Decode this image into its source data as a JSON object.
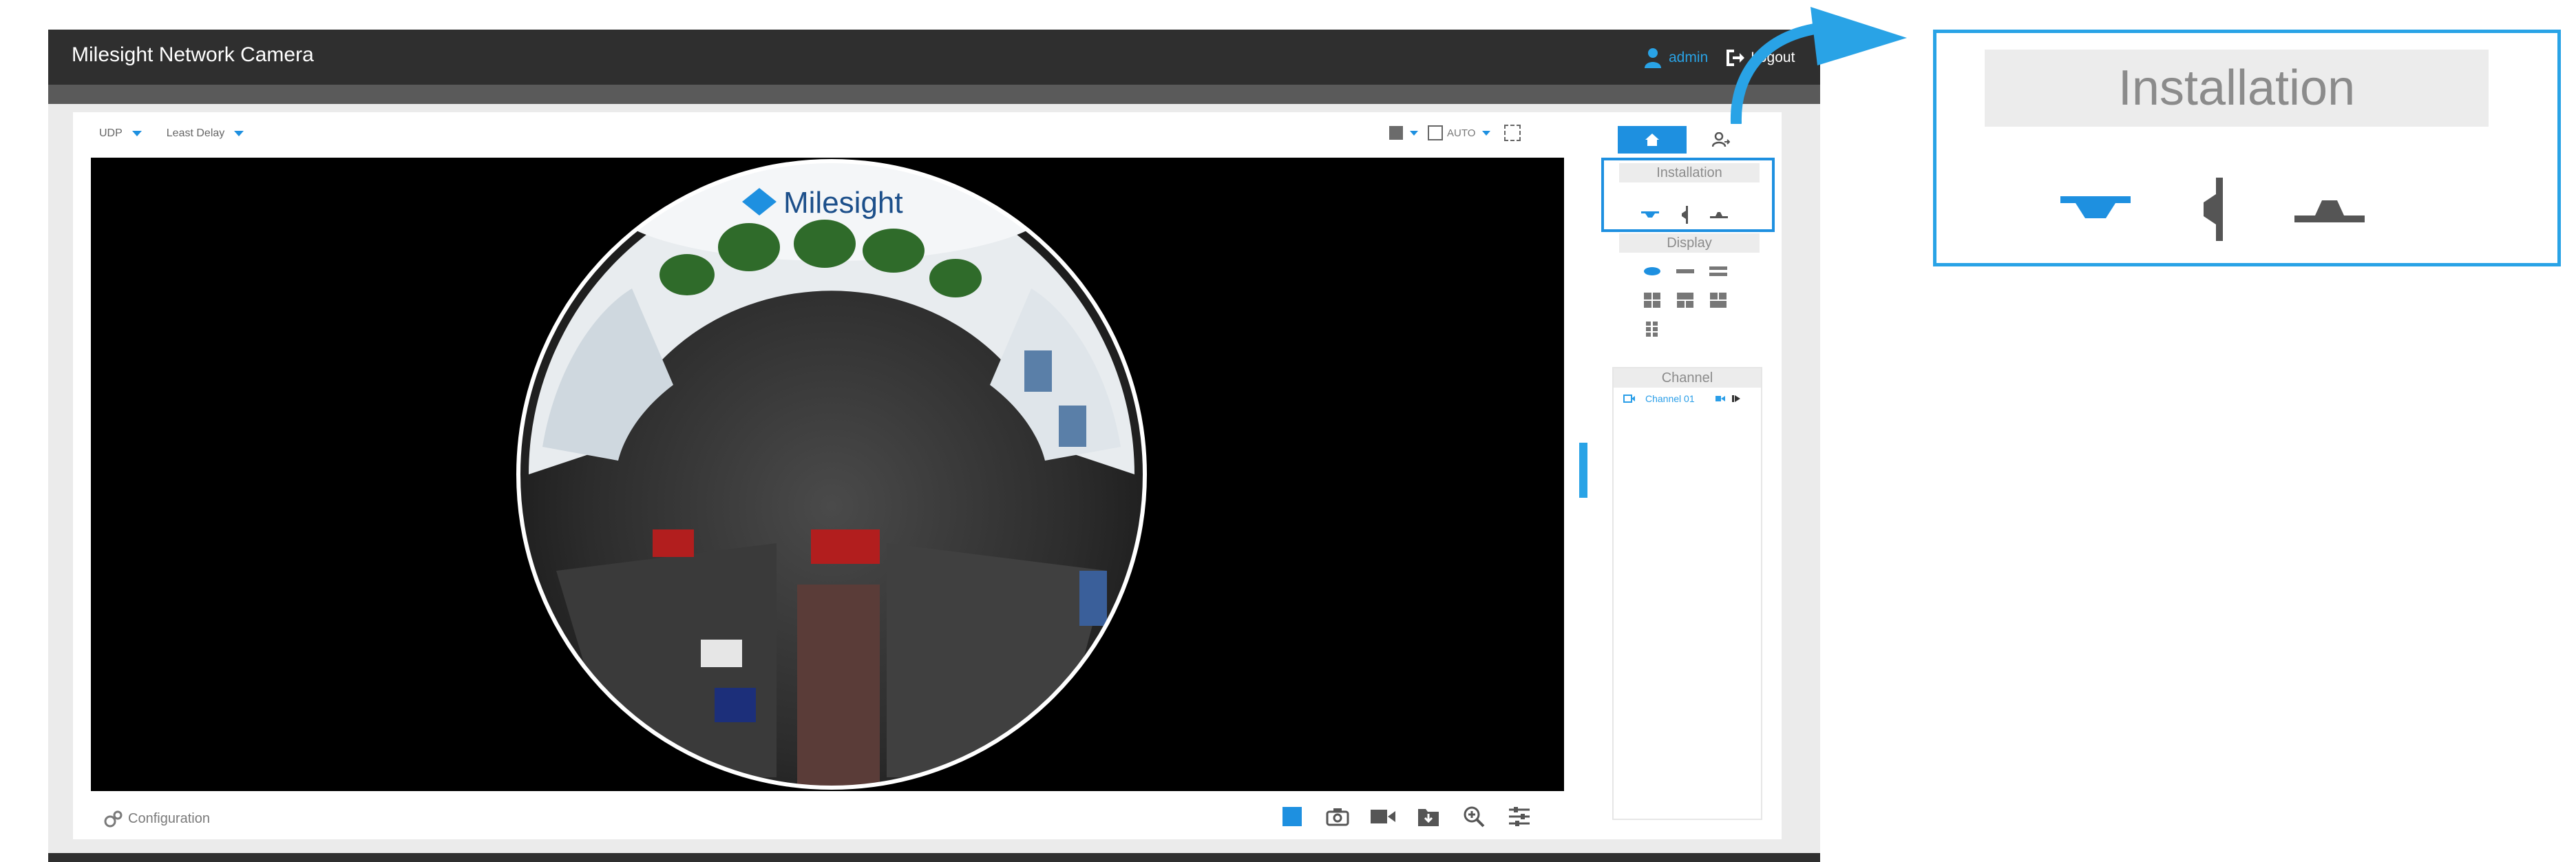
{
  "app": {
    "title": "Milesight Network Camera",
    "user": "admin",
    "logout_label": "Logout"
  },
  "stream": {
    "protocol": "UDP",
    "delay_mode": "Least Delay",
    "fit_mode": "AUTO"
  },
  "video": {
    "overlay_logo": "Milesight"
  },
  "bottom": {
    "config_label": "Configuration"
  },
  "right_panel": {
    "installation_label": "Installation",
    "display_label": "Display",
    "channel_label": "Channel",
    "channels": [
      {
        "name": "Channel 01"
      }
    ]
  },
  "callout": {
    "installation_label": "Installation"
  },
  "colors": {
    "accent": "#1e90e0",
    "topbar": "#2f2f2f",
    "panel_header": "#ececec"
  }
}
